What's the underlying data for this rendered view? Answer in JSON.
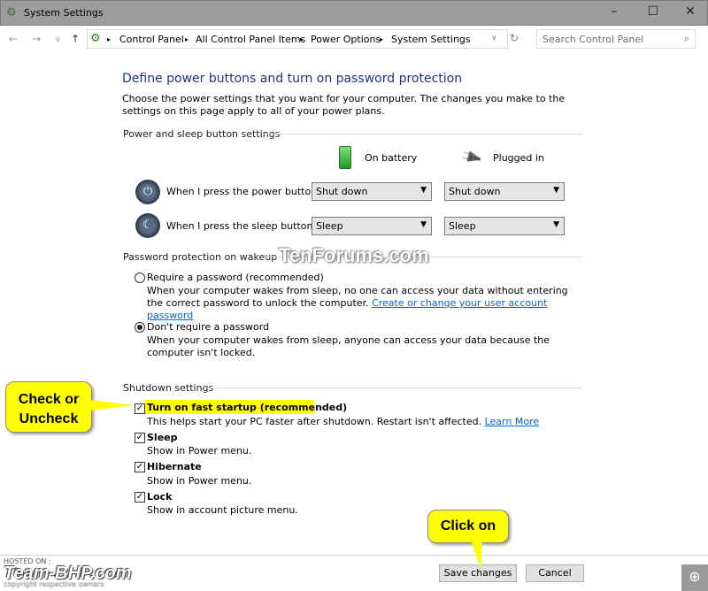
{
  "window": {
    "title": "System Settings",
    "minimize": "–",
    "maximize": "☐",
    "close": "✕"
  },
  "address": {
    "breadcrumbs": [
      "Control Panel",
      "All Control Panel Items",
      "Power Options",
      "System Settings"
    ],
    "search_placeholder": "Search Control Panel"
  },
  "main": {
    "title": "Define power buttons and turn on password protection",
    "description": "Choose the power settings that you want for your computer. The changes you make to the settings on this page apply to all of your power plans.",
    "power_group": {
      "label": "Power and sleep button settings",
      "col_battery": "On battery",
      "col_plugged": "Plugged in",
      "rows": [
        {
          "label": "When I press the power button:",
          "battery": "Shut down",
          "plugged": "Shut down"
        },
        {
          "label": "When I press the sleep button:",
          "battery": "Sleep",
          "plugged": "Sleep"
        }
      ]
    },
    "password_group": {
      "label": "Password protection on wakeup",
      "require": {
        "label": "Require a password (recommended)",
        "desc": "When your computer wakes from sleep, no one can access your data without entering the correct password to unlock the computer.",
        "link": "Create or change your user account password",
        "selected": false
      },
      "dont": {
        "label": "Don't require a password",
        "desc": "When your computer wakes from sleep, anyone can access your data because the computer isn't locked.",
        "selected": true
      }
    },
    "shutdown_group": {
      "label": "Shutdown settings",
      "items": [
        {
          "label": "Turn on fast startup (recommended)",
          "desc": "This helps start your PC faster after shutdown. Restart isn't affected.",
          "link": "Learn More",
          "checked": true
        },
        {
          "label": "Sleep",
          "desc": "Show in Power menu.",
          "checked": true
        },
        {
          "label": "Hibernate",
          "desc": "Show in Power menu.",
          "checked": true
        },
        {
          "label": "Lock",
          "desc": "Show in account picture menu.",
          "checked": true
        }
      ]
    }
  },
  "footer": {
    "save": "Save changes",
    "cancel": "Cancel"
  },
  "annotations": {
    "check": "Check or Uncheck",
    "click": "Click on",
    "watermark": "TenForums.com",
    "hosted": "HOSTED ON :",
    "logo": "Team-BHP.com",
    "copyright": "copyright respective owners"
  }
}
